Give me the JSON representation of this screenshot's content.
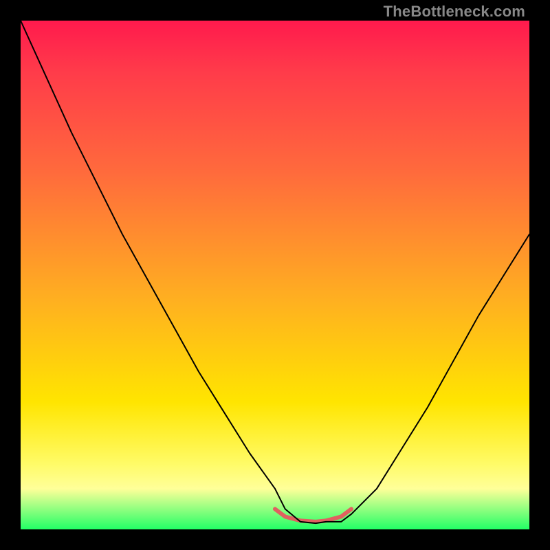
{
  "watermark": "TheBottleneck.com",
  "chart_data": {
    "type": "line",
    "title": "",
    "xlabel": "",
    "ylabel": "",
    "xlim": [
      0,
      100
    ],
    "ylim": [
      0,
      100
    ],
    "series": [
      {
        "name": "main-curve",
        "x": [
          0,
          5,
          10,
          15,
          20,
          25,
          30,
          35,
          40,
          45,
          50,
          52,
          55,
          58,
          60,
          63,
          65,
          70,
          75,
          80,
          85,
          90,
          95,
          100
        ],
        "y": [
          100,
          89,
          78,
          68,
          58,
          49,
          40,
          31,
          23,
          15,
          8,
          4,
          1.5,
          1.2,
          1.5,
          1.5,
          3,
          8,
          16,
          24,
          33,
          42,
          50,
          58
        ],
        "stroke": "#000000",
        "stroke_width": 2
      },
      {
        "name": "bottom-highlight",
        "x": [
          50,
          52,
          55,
          58,
          60,
          63,
          65
        ],
        "y": [
          4.0,
          2.5,
          1.7,
          1.5,
          1.7,
          2.5,
          4.0
        ],
        "stroke": "#e06060",
        "stroke_width": 6
      }
    ],
    "gradient_stops": [
      {
        "pos": 0.0,
        "color": "#ff1a4d"
      },
      {
        "pos": 0.1,
        "color": "#ff3b4a"
      },
      {
        "pos": 0.3,
        "color": "#ff6b3c"
      },
      {
        "pos": 0.55,
        "color": "#ffb020"
      },
      {
        "pos": 0.75,
        "color": "#ffe500"
      },
      {
        "pos": 0.87,
        "color": "#fffb66"
      },
      {
        "pos": 0.92,
        "color": "#ffff99"
      },
      {
        "pos": 1.0,
        "color": "#22ff66"
      }
    ]
  }
}
